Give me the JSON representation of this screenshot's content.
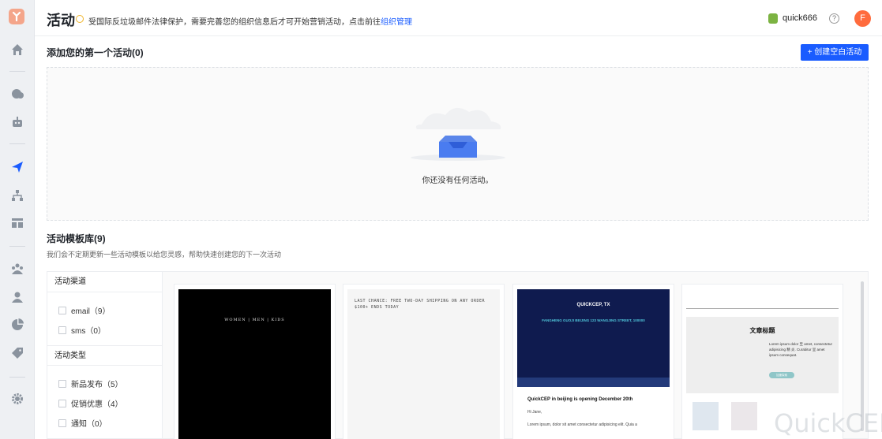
{
  "header": {
    "title": "活动",
    "notice_text": "受国际反垃圾邮件法律保护，需要完善您的组织信息后才可开始营销活动，点击前往",
    "notice_link": "组织管理",
    "username": "quick666",
    "avatar_letter": "F"
  },
  "section_campaigns": {
    "title": "添加您的第一个活动(0)",
    "create_button": "+ 创建空白活动",
    "empty_text": "你还没有任何活动。"
  },
  "section_templates": {
    "title": "活动模板库(9)",
    "subtitle": "我们会不定期更新一些活动模板以给您灵感，帮助快速创建您的下一次活动"
  },
  "filters": {
    "channel_title": "活动渠道",
    "channels": [
      {
        "label": "email（9）"
      },
      {
        "label": "sms（0）"
      }
    ],
    "type_title": "活动类型",
    "types": [
      {
        "label": "新品发布（5）"
      },
      {
        "label": "促销优惠（4）"
      },
      {
        "label": "通知（0）"
      }
    ]
  },
  "templates": {
    "t1_nav": "WOMEN | MEN | KIDS",
    "t2_text": "LAST CHANCE: FREE TWO-DAY SHIPPING ON ANY ORDER $100+ ENDS TODAY",
    "t3_company": "QUICKCEP, TX",
    "t3_address": "FANGHENG GUOJI BEIJING 123 WANGJING STREET, 100000",
    "t3_headline": "QuickCEP in beijing is opening December 20th",
    "t3_greeting": "Hi Jane,",
    "t3_body": "Lorem ipsum, dolor sit amet consectetur adipisicing elit. Quia a",
    "t4_heading": "文章标题",
    "t4_body": "Lorem ipsum dolor 至 amet, consectetur adipisicing 精 炎. Curabitur 呈 amet ipsum consequat.",
    "t4_button": "加速探索"
  },
  "watermark": "QuickCEP",
  "colors": {
    "primary": "#1a5cff",
    "avatar": "#ff6b3d",
    "sidebar_bg": "#eef0f3"
  }
}
